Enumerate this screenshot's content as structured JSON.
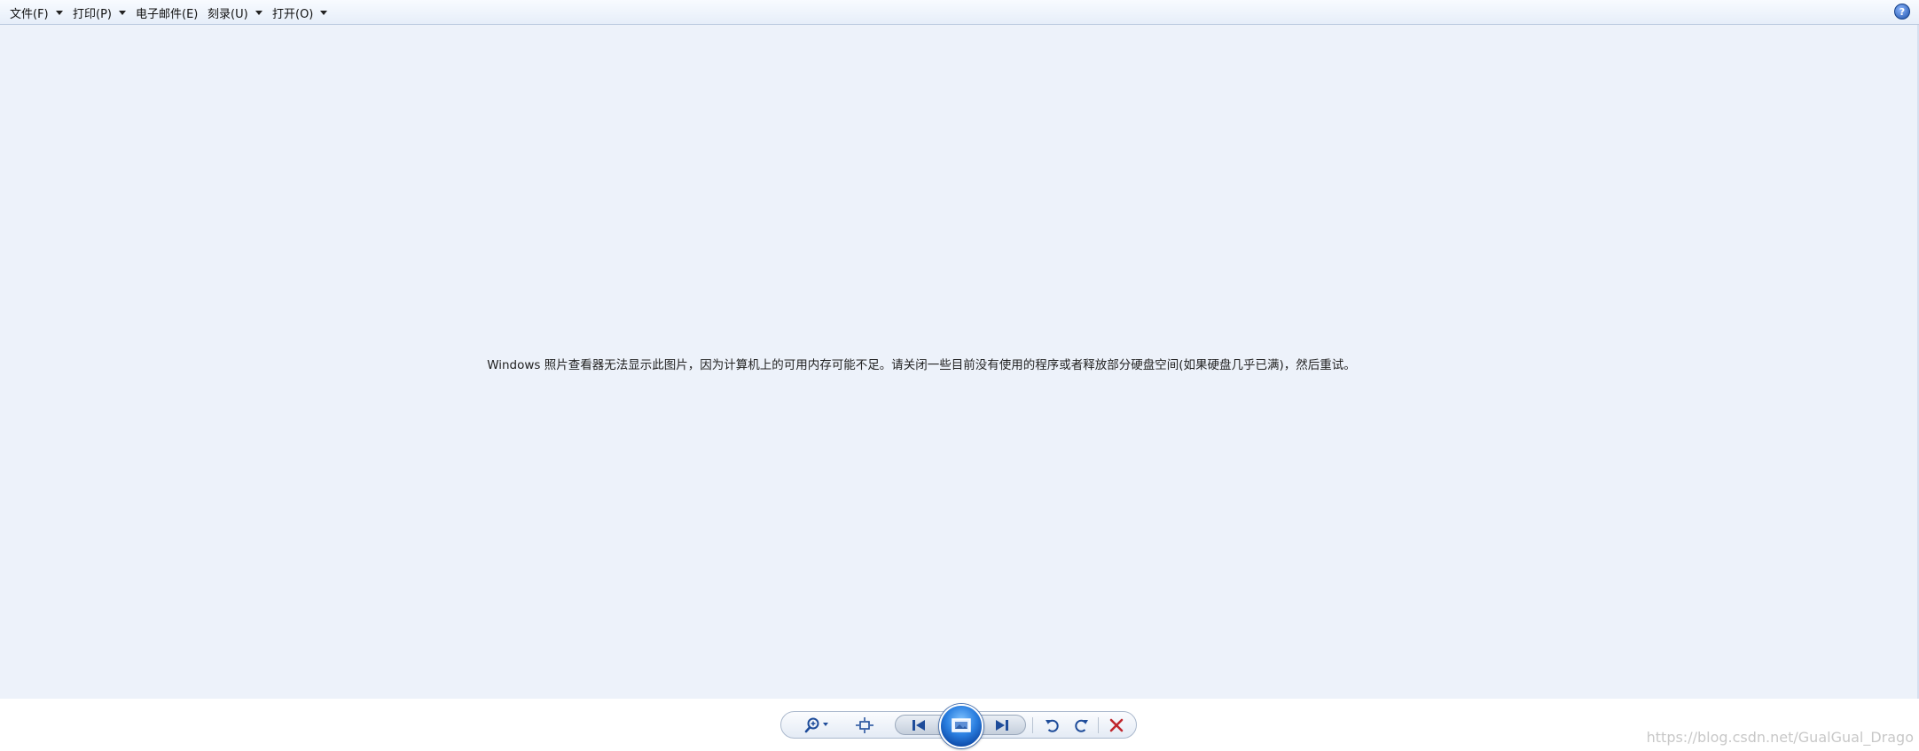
{
  "menu": {
    "items": [
      {
        "label": "文件(F)",
        "has_dropdown": true
      },
      {
        "label": "打印(P)",
        "has_dropdown": true
      },
      {
        "label": "电子邮件(E)",
        "has_dropdown": false
      },
      {
        "label": "刻录(U)",
        "has_dropdown": true
      },
      {
        "label": "打开(O)",
        "has_dropdown": true
      }
    ],
    "help_label": "?"
  },
  "viewer": {
    "message": "Windows 照片查看器无法显示此图片，因为计算机上的可用内存可能不足。请关闭一些目前没有使用的程序或者释放部分硬盘空间(如果硬盘几乎已满)，然后重试。"
  },
  "toolbar": {
    "buttons": [
      {
        "name": "zoom-button",
        "icon": "magnifier-icon"
      },
      {
        "name": "actual-size-button",
        "icon": "fit-window-icon"
      },
      {
        "name": "previous-button",
        "icon": "previous-icon"
      },
      {
        "name": "slideshow-button",
        "icon": "slideshow-icon"
      },
      {
        "name": "next-button",
        "icon": "next-icon"
      },
      {
        "name": "rotate-counterclockwise-button",
        "icon": "rotate-left-icon"
      },
      {
        "name": "rotate-clockwise-button",
        "icon": "rotate-right-icon"
      },
      {
        "name": "delete-button",
        "icon": "delete-x-icon"
      }
    ]
  },
  "watermark": "https://blog.csdn.net/GualGual_Drago",
  "colors": {
    "viewer_bg": "#edf2fa",
    "accent": "#1a4fa8",
    "delete_red": "#c0272d"
  }
}
